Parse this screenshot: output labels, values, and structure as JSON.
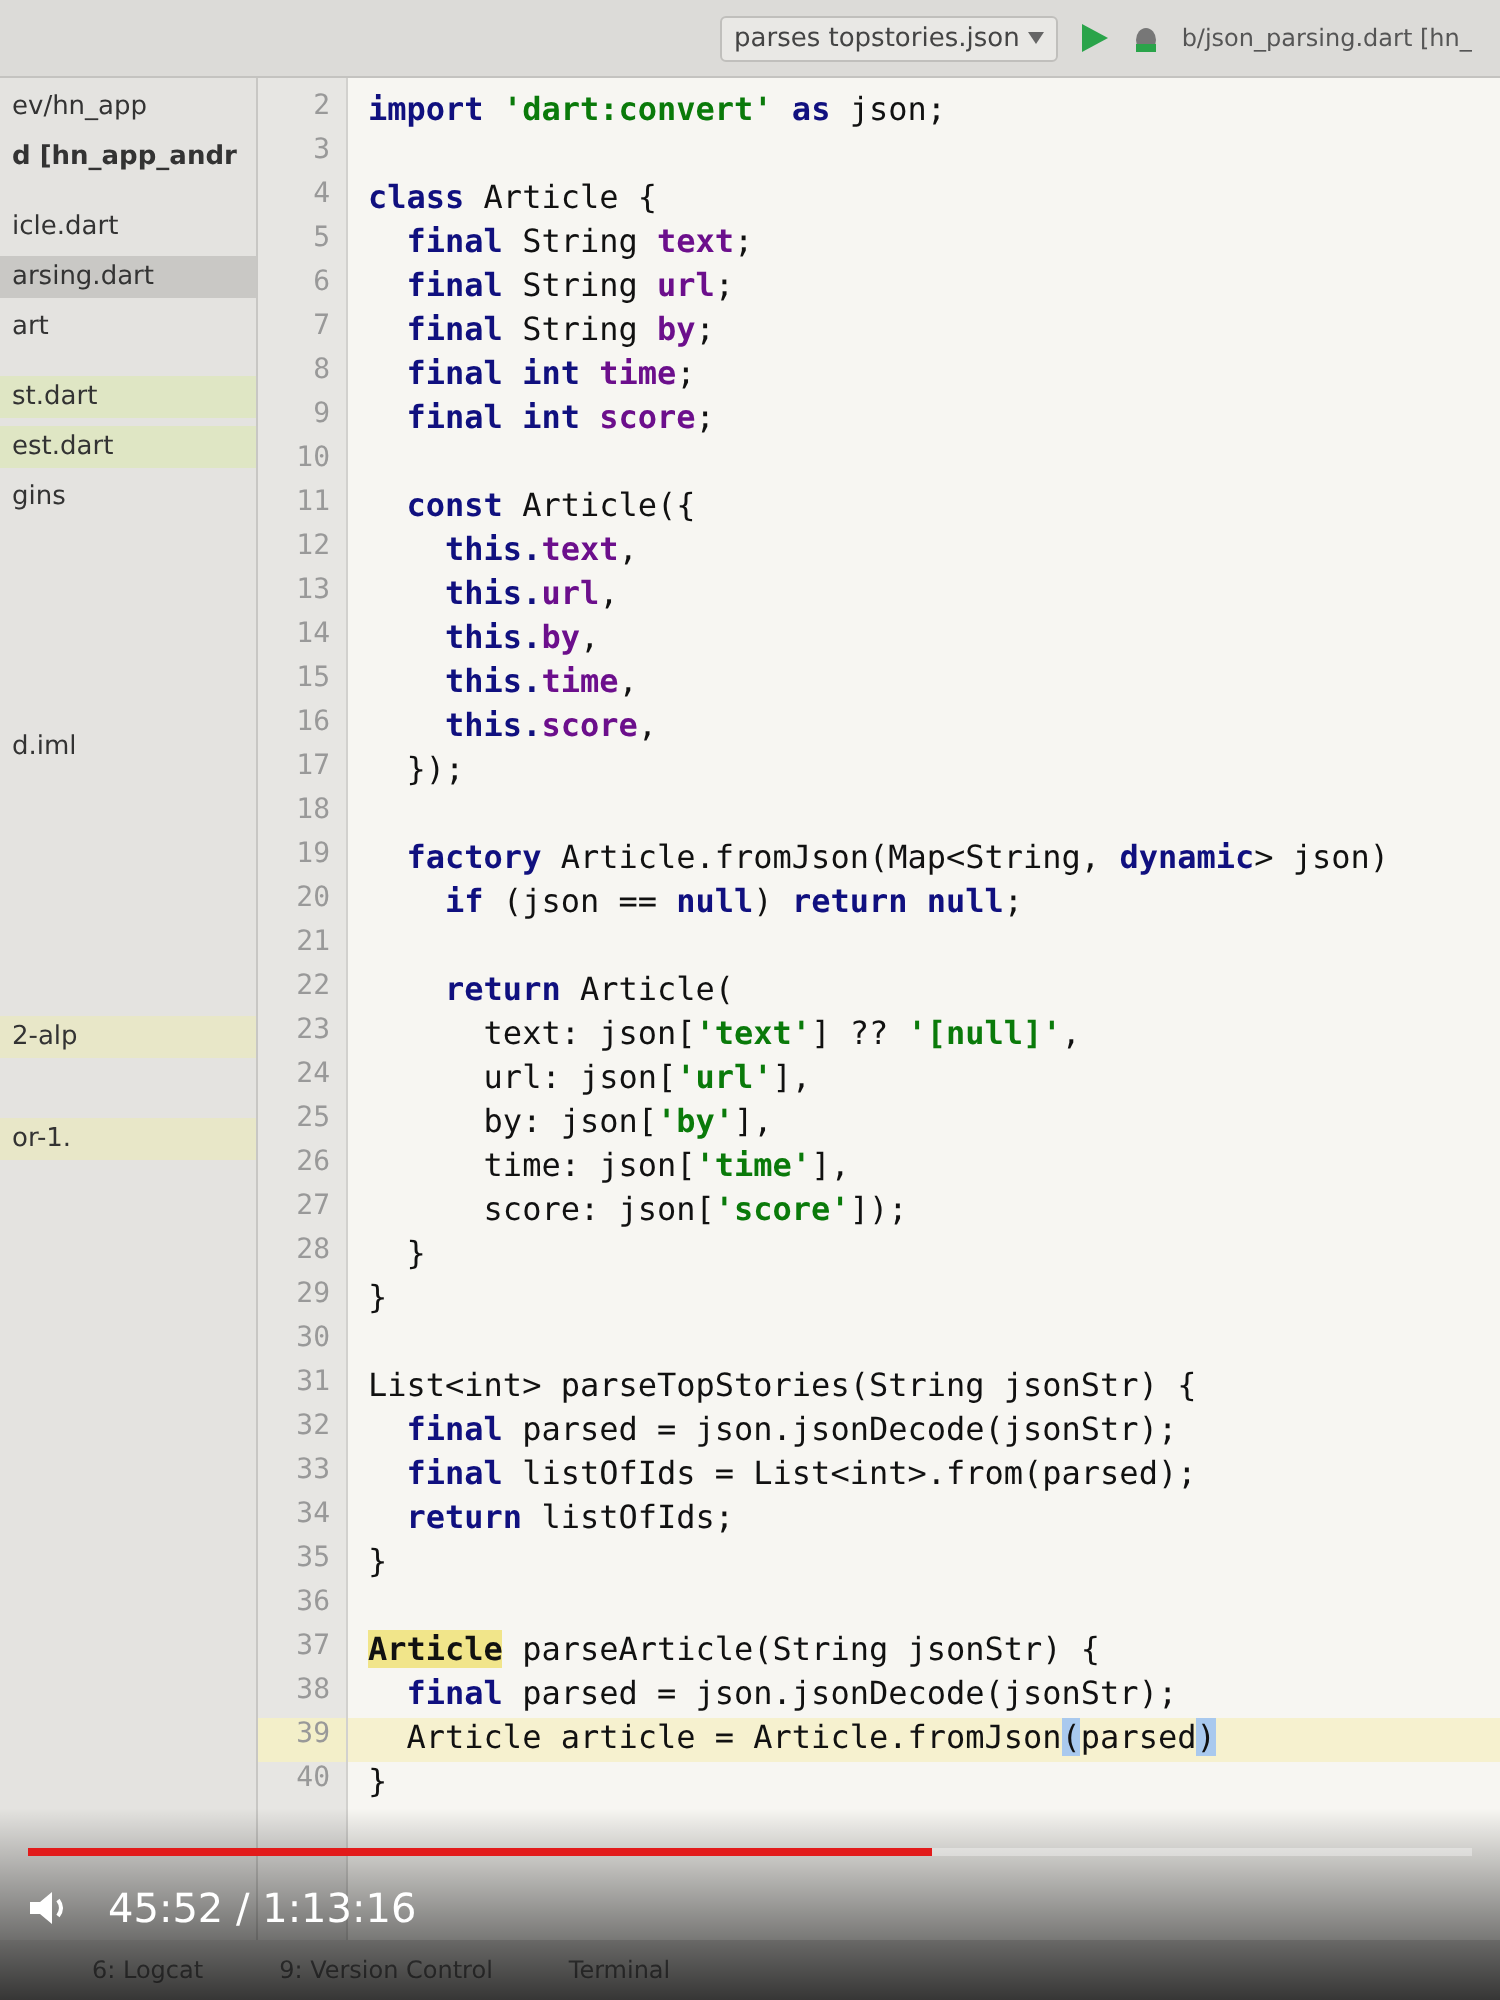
{
  "window": {
    "title": "b/json_parsing.dart [hn_"
  },
  "toolbar": {
    "run_config": "parses topstories.json"
  },
  "project": {
    "items": [
      {
        "label": "ev/hn_app",
        "kind": "folder",
        "selected": false
      },
      {
        "label": "d [hn_app_andr",
        "kind": "module",
        "selected": false
      },
      {
        "label": "icle.dart",
        "kind": "file",
        "selected": false
      },
      {
        "label": "arsing.dart",
        "kind": "file",
        "selected": true
      },
      {
        "label": "art",
        "kind": "file",
        "selected": false
      },
      {
        "label": "st.dart",
        "kind": "test",
        "selected": false
      },
      {
        "label": "est.dart",
        "kind": "test",
        "selected": false
      },
      {
        "label": "gins",
        "kind": "folder",
        "selected": false
      },
      {
        "label": "d.iml",
        "kind": "file",
        "selected": false
      },
      {
        "label": "2-alp",
        "kind": "library",
        "selected": false
      },
      {
        "label": "or-1.",
        "kind": "library",
        "selected": false
      }
    ]
  },
  "editor": {
    "lines": [
      {
        "number": "2",
        "tokens": [
          {
            "t": "import ",
            "kind": "kw"
          },
          {
            "t": "'dart:convert'",
            "kind": "str"
          },
          {
            "t": " as ",
            "kind": "kw"
          },
          {
            "t": "json;",
            "kind": "plain"
          }
        ]
      },
      {
        "number": "3"
      },
      {
        "number": "4",
        "tokens": [
          {
            "t": "class ",
            "kind": "kw"
          },
          {
            "t": "Article {",
            "kind": "plain"
          }
        ]
      },
      {
        "number": "5",
        "tokens": [
          {
            "t": "  final ",
            "kind": "kw"
          },
          {
            "t": "String ",
            "kind": "plain"
          },
          {
            "t": "text",
            "kind": "field"
          },
          {
            "t": ";",
            "kind": "plain"
          }
        ]
      },
      {
        "number": "6",
        "tokens": [
          {
            "t": "  final ",
            "kind": "kw"
          },
          {
            "t": "String ",
            "kind": "plain"
          },
          {
            "t": "url",
            "kind": "field"
          },
          {
            "t": ";",
            "kind": "plain"
          }
        ]
      },
      {
        "number": "7",
        "tokens": [
          {
            "t": "  final ",
            "kind": "kw"
          },
          {
            "t": "String ",
            "kind": "plain"
          },
          {
            "t": "by",
            "kind": "field"
          },
          {
            "t": ";",
            "kind": "plain"
          }
        ]
      },
      {
        "number": "8",
        "tokens": [
          {
            "t": "  final int ",
            "kind": "kw"
          },
          {
            "t": "time",
            "kind": "field"
          },
          {
            "t": ";",
            "kind": "plain"
          }
        ]
      },
      {
        "number": "9",
        "tokens": [
          {
            "t": "  final int ",
            "kind": "kw"
          },
          {
            "t": "score",
            "kind": "field"
          },
          {
            "t": ";",
            "kind": "plain"
          }
        ]
      },
      {
        "number": "10"
      },
      {
        "number": "11",
        "tokens": [
          {
            "t": "  const ",
            "kind": "kw"
          },
          {
            "t": "Article({",
            "kind": "plain"
          }
        ]
      },
      {
        "number": "12",
        "tokens": [
          {
            "t": "    this.",
            "kind": "kw"
          },
          {
            "t": "text",
            "kind": "field"
          },
          {
            "t": ",",
            "kind": "plain"
          }
        ]
      },
      {
        "number": "13",
        "tokens": [
          {
            "t": "    this.",
            "kind": "kw"
          },
          {
            "t": "url",
            "kind": "field"
          },
          {
            "t": ",",
            "kind": "plain"
          }
        ]
      },
      {
        "number": "14",
        "tokens": [
          {
            "t": "    this.",
            "kind": "kw"
          },
          {
            "t": "by",
            "kind": "field"
          },
          {
            "t": ",",
            "kind": "plain"
          }
        ]
      },
      {
        "number": "15",
        "tokens": [
          {
            "t": "    this.",
            "kind": "kw"
          },
          {
            "t": "time",
            "kind": "field"
          },
          {
            "t": ",",
            "kind": "plain"
          }
        ]
      },
      {
        "number": "16",
        "tokens": [
          {
            "t": "    this.",
            "kind": "kw"
          },
          {
            "t": "score",
            "kind": "field"
          },
          {
            "t": ",",
            "kind": "plain"
          }
        ]
      },
      {
        "number": "17",
        "tokens": [
          {
            "t": "  });",
            "kind": "plain"
          }
        ]
      },
      {
        "number": "18"
      },
      {
        "number": "19",
        "tokens": [
          {
            "t": "  factory ",
            "kind": "kw"
          },
          {
            "t": "Article.fromJson(Map<String, ",
            "kind": "plain"
          },
          {
            "t": "dynamic",
            "kind": "kw"
          },
          {
            "t": "> json)",
            "kind": "plain"
          }
        ]
      },
      {
        "number": "20",
        "tokens": [
          {
            "t": "    if ",
            "kind": "kw"
          },
          {
            "t": "(json == ",
            "kind": "plain"
          },
          {
            "t": "null",
            "kind": "kw"
          },
          {
            "t": ") ",
            "kind": "plain"
          },
          {
            "t": "return null",
            "kind": "kw"
          },
          {
            "t": ";",
            "kind": "plain"
          }
        ]
      },
      {
        "number": "21"
      },
      {
        "number": "22",
        "tokens": [
          {
            "t": "    return ",
            "kind": "kw"
          },
          {
            "t": "Article(",
            "kind": "plain"
          }
        ]
      },
      {
        "number": "23",
        "tokens": [
          {
            "t": "      text: json[",
            "kind": "plain"
          },
          {
            "t": "'text'",
            "kind": "str"
          },
          {
            "t": "] ?? ",
            "kind": "plain"
          },
          {
            "t": "'[null]'",
            "kind": "str"
          },
          {
            "t": ",",
            "kind": "plain"
          }
        ]
      },
      {
        "number": "24",
        "tokens": [
          {
            "t": "      url: json[",
            "kind": "plain"
          },
          {
            "t": "'url'",
            "kind": "str"
          },
          {
            "t": "],",
            "kind": "plain"
          }
        ]
      },
      {
        "number": "25",
        "tokens": [
          {
            "t": "      by: json[",
            "kind": "plain"
          },
          {
            "t": "'by'",
            "kind": "str"
          },
          {
            "t": "],",
            "kind": "plain"
          }
        ]
      },
      {
        "number": "26",
        "tokens": [
          {
            "t": "      time: json[",
            "kind": "plain"
          },
          {
            "t": "'time'",
            "kind": "str"
          },
          {
            "t": "],",
            "kind": "plain"
          }
        ]
      },
      {
        "number": "27",
        "tokens": [
          {
            "t": "      score: json[",
            "kind": "plain"
          },
          {
            "t": "'score'",
            "kind": "str"
          },
          {
            "t": "]);",
            "kind": "plain"
          }
        ]
      },
      {
        "number": "28",
        "tokens": [
          {
            "t": "  }",
            "kind": "plain"
          }
        ]
      },
      {
        "number": "29",
        "tokens": [
          {
            "t": "}",
            "kind": "plain"
          }
        ]
      },
      {
        "number": "30"
      },
      {
        "number": "31",
        "tokens": [
          {
            "t": "List<int> parseTopStories(String jsonStr) {",
            "kind": "plain"
          }
        ]
      },
      {
        "number": "32",
        "tokens": [
          {
            "t": "  final ",
            "kind": "kw"
          },
          {
            "t": "parsed = json.jsonDecode(jsonStr);",
            "kind": "plain"
          }
        ]
      },
      {
        "number": "33",
        "tokens": [
          {
            "t": "  final ",
            "kind": "kw"
          },
          {
            "t": "listOfIds = List<int>.from(parsed);",
            "kind": "plain"
          }
        ]
      },
      {
        "number": "34",
        "tokens": [
          {
            "t": "  return ",
            "kind": "kw"
          },
          {
            "t": "listOfIds;",
            "kind": "plain"
          }
        ]
      },
      {
        "number": "35",
        "tokens": [
          {
            "t": "}",
            "kind": "plain"
          }
        ]
      },
      {
        "number": "36"
      },
      {
        "number": "37",
        "tokens": [
          {
            "t": "Article",
            "kind": "usage"
          },
          {
            "t": " parseArticle(String jsonStr) {",
            "kind": "plain"
          }
        ]
      },
      {
        "number": "38",
        "tokens": [
          {
            "t": "  final ",
            "kind": "kw"
          },
          {
            "t": "parsed = json.jsonDecode(jsonStr);",
            "kind": "plain"
          }
        ]
      },
      {
        "number": "39",
        "current": true,
        "tokens": [
          {
            "t": "  Article article = Article.fromJson",
            "kind": "plain"
          },
          {
            "t": "(",
            "kind": "brace"
          },
          {
            "t": "parsed",
            "kind": "plain"
          },
          {
            "t": ")",
            "kind": "brace"
          }
        ]
      },
      {
        "number": "40",
        "tokens": [
          {
            "t": "}",
            "kind": "plain"
          }
        ]
      }
    ]
  },
  "tool_tabs": [
    "6: Logcat",
    "9: Version Control",
    "Terminal"
  ],
  "player": {
    "time": "45:52 / 1:13:16",
    "level": 0.626
  }
}
